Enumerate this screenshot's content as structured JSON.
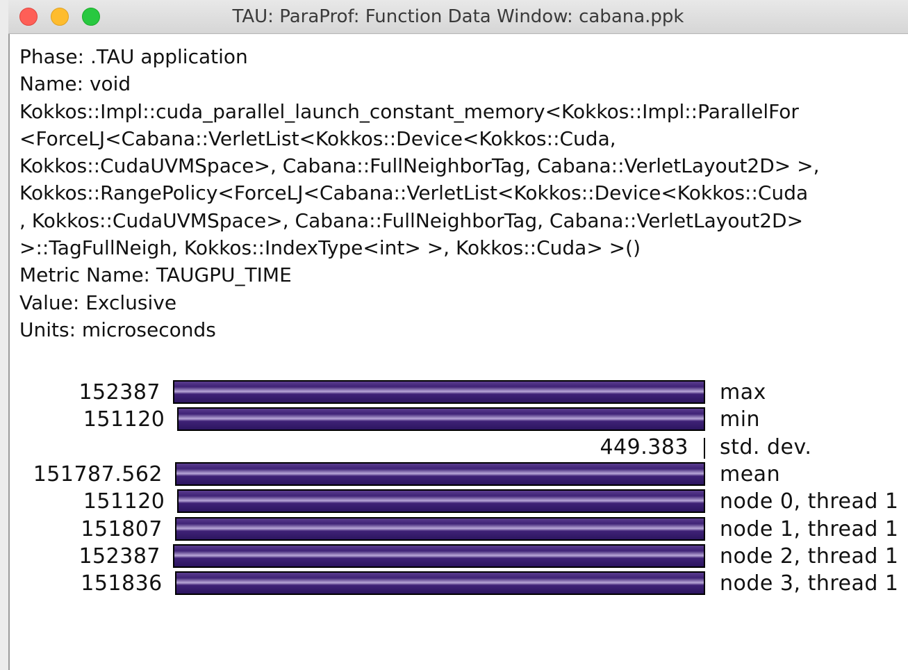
{
  "window": {
    "title": "TAU: ParaProf: Function Data Window: cabana.ppk"
  },
  "info": [
    "Phase: .TAU application",
    "Name: void",
    "Kokkos::Impl::cuda_parallel_launch_constant_memory<Kokkos::Impl::ParallelFor",
    "<ForceLJ<Cabana::VerletList<Kokkos::Device<Kokkos::Cuda,",
    "Kokkos::CudaUVMSpace>, Cabana::FullNeighborTag, Cabana::VerletLayout2D> >,",
    "Kokkos::RangePolicy<ForceLJ<Cabana::VerletList<Kokkos::Device<Kokkos::Cuda",
    ", Kokkos::CudaUVMSpace>, Cabana::FullNeighborTag, Cabana::VerletLayout2D>",
    ">::TagFullNeigh, Kokkos::IndexType<int> >, Kokkos::Cuda> >()",
    "Metric Name: TAUGPU_TIME",
    "Value: Exclusive",
    "Units: microseconds"
  ],
  "chart_data": {
    "type": "bar",
    "orientation": "horizontal",
    "metric": "TAUGPU_TIME",
    "units": "microseconds",
    "bar_color": "#3f2276",
    "rows": [
      {
        "label": "max",
        "display": "152387",
        "value": 152387
      },
      {
        "label": "min",
        "display": "151120",
        "value": 151120
      },
      {
        "label": "std. dev.",
        "display": "449.383",
        "value": 449.383
      },
      {
        "label": "mean",
        "display": "151787.562",
        "value": 151787.562
      },
      {
        "label": "node 0, thread 1",
        "display": "151120",
        "value": 151120
      },
      {
        "label": "node 1, thread 1",
        "display": "151807",
        "value": 151807
      },
      {
        "label": "node 2, thread 1",
        "display": "152387",
        "value": 152387
      },
      {
        "label": "node 3, thread 1",
        "display": "151836",
        "value": 151836
      }
    ]
  }
}
